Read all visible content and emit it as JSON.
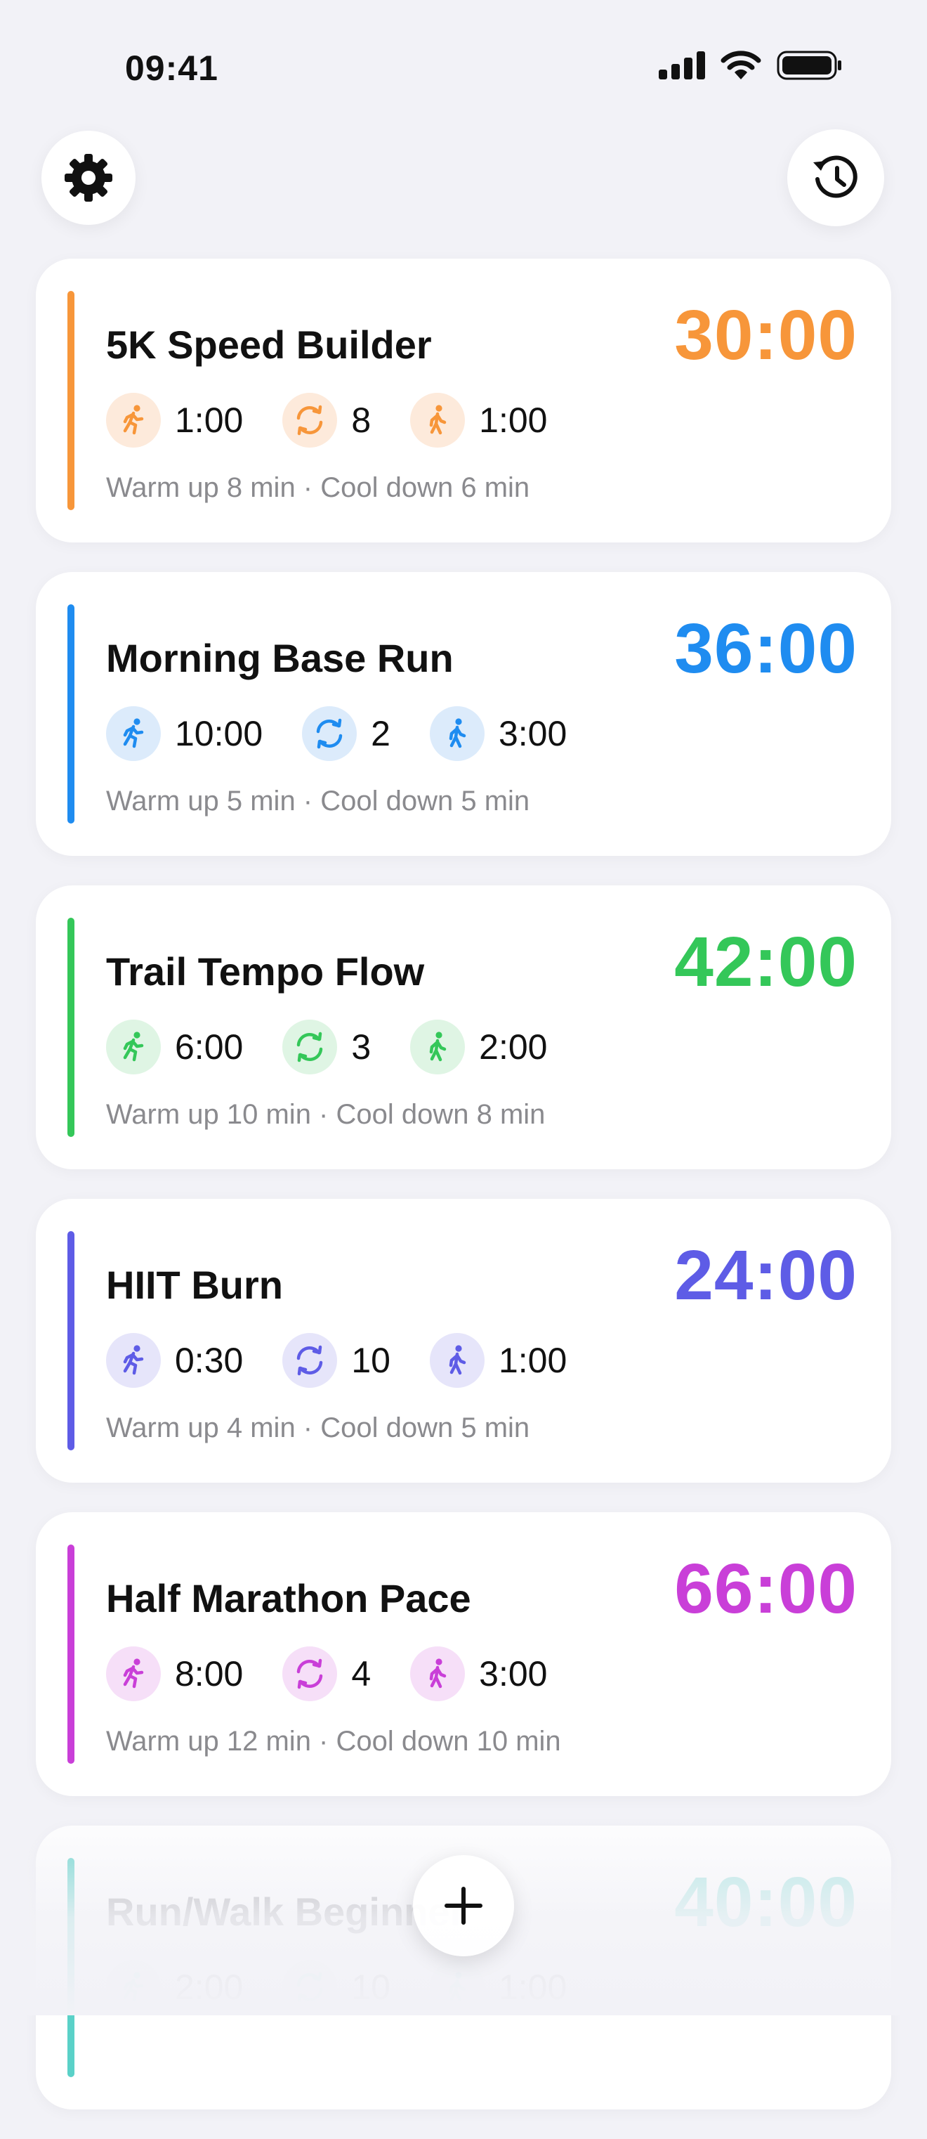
{
  "status_bar": {
    "time": "09:41"
  },
  "workouts": [
    {
      "title": "5K Speed Builder",
      "total": "30:00",
      "accent": "#f7963a",
      "chip_bg": "#fdeadb",
      "run": "1:00",
      "repeats": "8",
      "walk": "1:00",
      "note": "Warm up 8 min · Cool down 6 min",
      "faded": false
    },
    {
      "title": "Morning Base Run",
      "total": "36:00",
      "accent": "#1f8cf0",
      "chip_bg": "#dcebfb",
      "run": "10:00",
      "repeats": "2",
      "walk": "3:00",
      "note": "Warm up 5 min · Cool down 5 min",
      "faded": false
    },
    {
      "title": "Trail Tempo Flow",
      "total": "42:00",
      "accent": "#34c759",
      "chip_bg": "#dff5e4",
      "run": "6:00",
      "repeats": "3",
      "walk": "2:00",
      "note": "Warm up 10 min · Cool down 8 min",
      "faded": false
    },
    {
      "title": "HIIT Burn",
      "total": "24:00",
      "accent": "#5e5ce6",
      "chip_bg": "#e6e5fa",
      "run": "0:30",
      "repeats": "10",
      "walk": "1:00",
      "note": "Warm up 4 min · Cool down 5 min",
      "faded": false
    },
    {
      "title": "Half Marathon Pace",
      "total": "66:00",
      "accent": "#c93fd8",
      "chip_bg": "#f6dff8",
      "run": "8:00",
      "repeats": "4",
      "walk": "3:00",
      "note": "Warm up 12 min · Cool down 10 min",
      "faded": false
    },
    {
      "title": "Run/Walk Beginner",
      "total": "40:00",
      "accent": "#5ad1c8",
      "chip_bg": "#dff5f3",
      "run": "2:00",
      "repeats": "10",
      "walk": "1:00",
      "note": "",
      "faded": true
    }
  ],
  "icons": {
    "settings": "gear-icon",
    "history": "history-icon",
    "add": "plus-icon",
    "run": "running-figure-icon",
    "repeat": "repeat-cycle-icon",
    "walk": "walking-figure-icon"
  }
}
